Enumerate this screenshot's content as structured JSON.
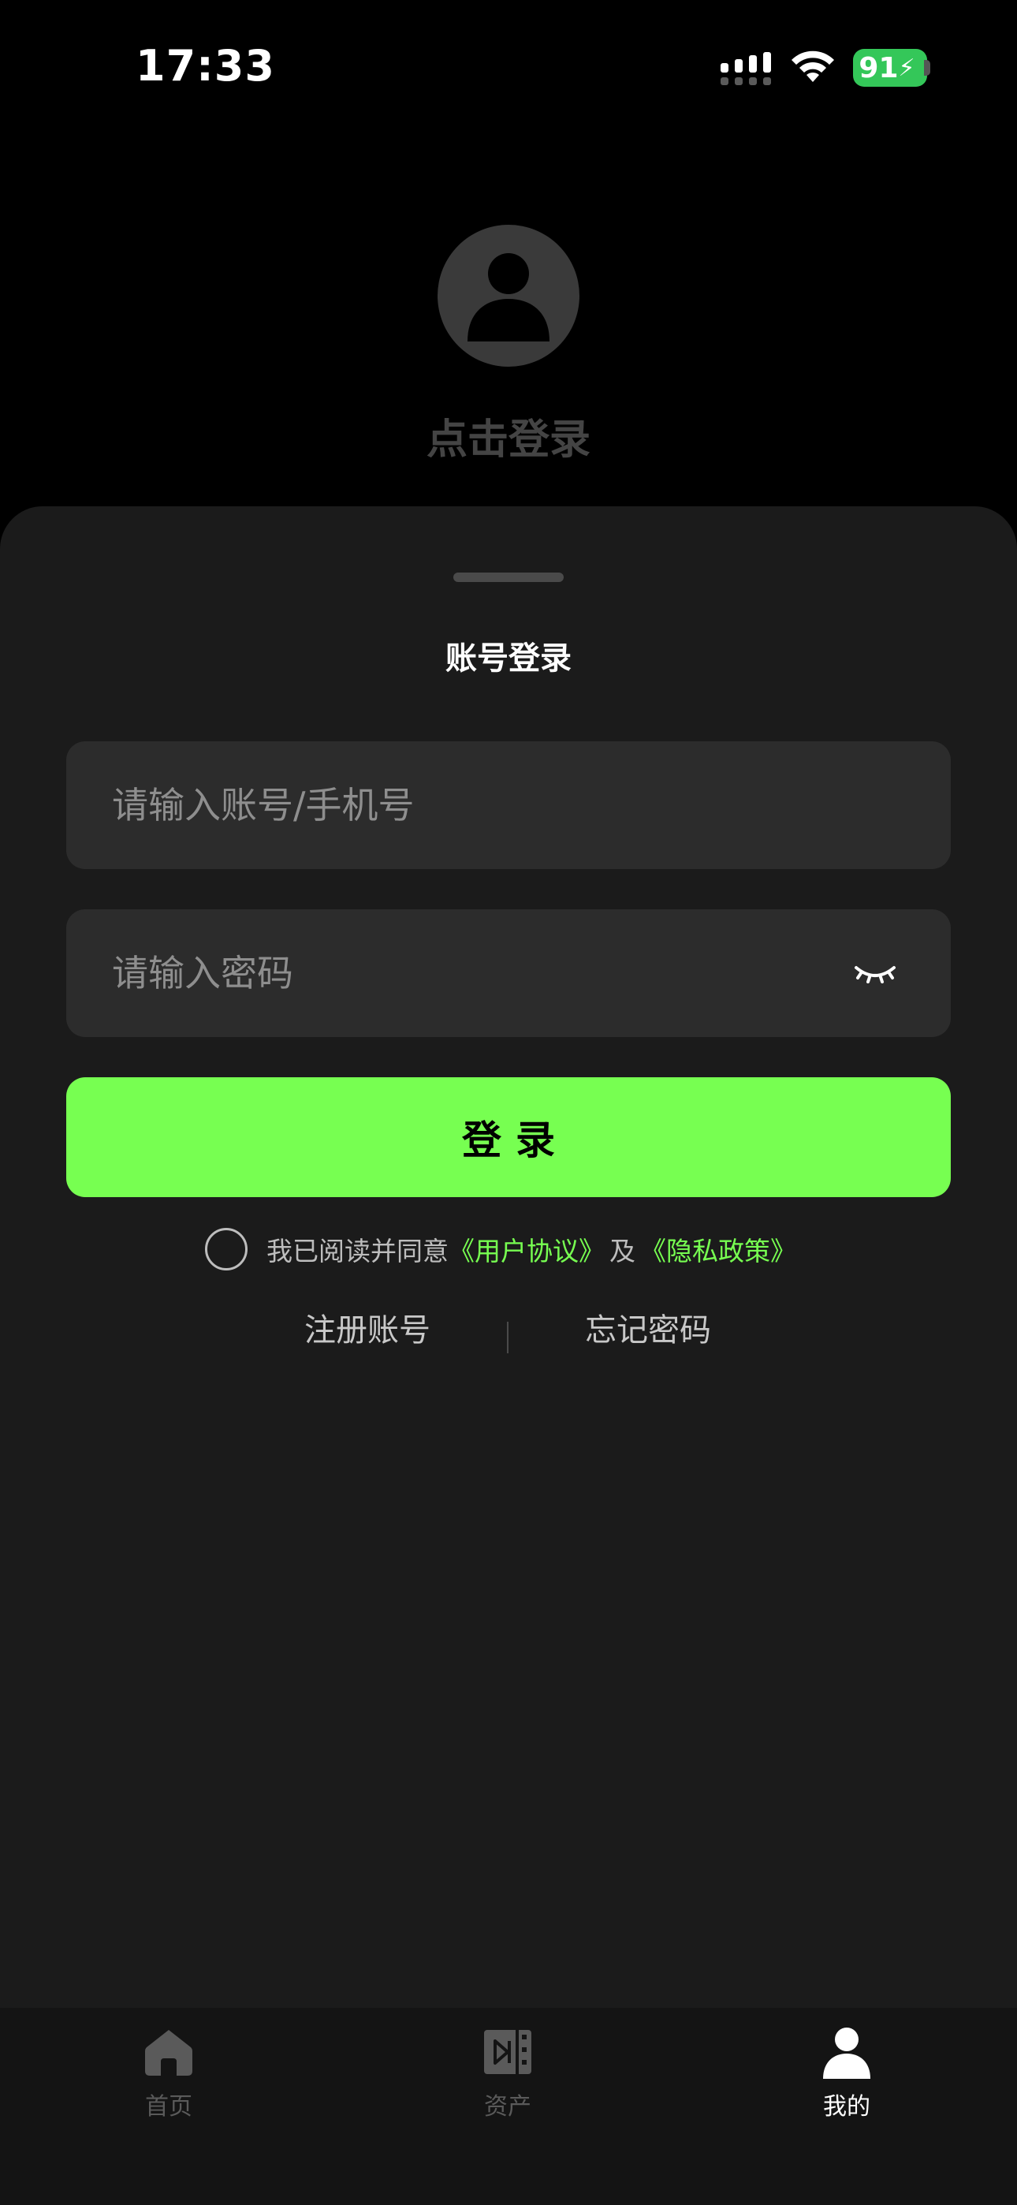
{
  "status_bar": {
    "time": "17:33",
    "battery": "91",
    "icons": [
      "signal-icon",
      "wifi-icon",
      "battery-charging-icon"
    ]
  },
  "header": {
    "avatar_icon": "person-avatar-icon",
    "login_prompt": "点击登录"
  },
  "sheet": {
    "title": "账号登录",
    "account_placeholder": "请输入账号/手机号",
    "account_value": "",
    "password_placeholder": "请输入密码",
    "password_value": "",
    "password_toggle_icon": "eye-closed-icon",
    "login_button": "登录",
    "agreement": {
      "prefix": "我已阅读并同意",
      "user_agreement": "《用户协议》",
      "and": "及",
      "privacy_policy": "《隐私政策》",
      "checked": false
    },
    "register_link": "注册账号",
    "forgot_link": "忘记密码"
  },
  "tab_bar": {
    "items": [
      {
        "label": "首页",
        "icon": "home-icon",
        "active": false
      },
      {
        "label": "资产",
        "icon": "assets-icon",
        "active": false
      },
      {
        "label": "我的",
        "icon": "person-icon",
        "active": true
      }
    ]
  },
  "colors": {
    "accent": "#77ff51",
    "background": "#000000",
    "sheet": "#1b1b1b",
    "field": "#2c2c2c",
    "battery": "#34c759"
  }
}
